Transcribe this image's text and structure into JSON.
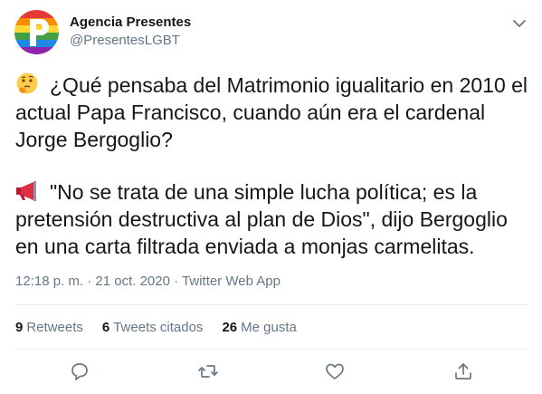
{
  "author": {
    "name": "Agencia Presentes",
    "handle": "@PresentesLGBT"
  },
  "tweet": {
    "paragraph1_emoji": "thinking-face",
    "paragraph1_text": "¿Qué pensaba del Matrimonio igualitario en 2010 el actual Papa Francisco, cuando aún era el cardenal Jorge Bergoglio?",
    "paragraph2_emoji": "loudspeaker",
    "paragraph2_text": "\"No se trata de una simple lucha política; es la pretensión destructiva al plan de Dios\", dijo Bergoglio en una carta filtrada enviada a monjas carmelitas."
  },
  "meta": {
    "time": "12:18 p. m.",
    "separator": " · ",
    "date": "21 oct. 2020",
    "app": "Twitter Web App"
  },
  "stats": {
    "retweets_count": "9",
    "retweets_label": "Retweets",
    "quotes_count": "6",
    "quotes_label": "Tweets citados",
    "likes_count": "26",
    "likes_label": "Me gusta"
  },
  "icons": {
    "reply": "reply-icon",
    "retweet": "retweet-icon",
    "like": "heart-icon",
    "share": "share-icon",
    "more": "chevron-down-icon"
  },
  "colors": {
    "text": "#14171a",
    "secondary": "#657786",
    "divider": "#e6ecf0"
  }
}
